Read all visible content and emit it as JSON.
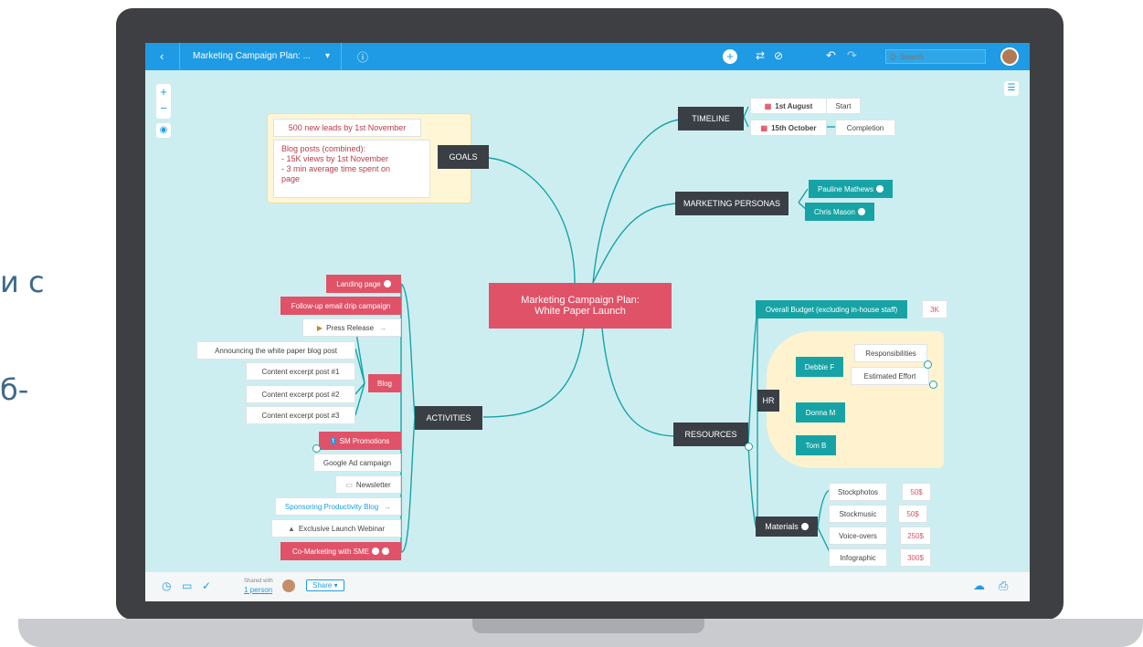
{
  "side_text": {
    "line1": "и с",
    "line2": "б-"
  },
  "header": {
    "back_icon": "chevron-left-icon",
    "doc_title": "Marketing Campaign Plan: ...",
    "dropdown_icon": "caret-down-icon",
    "info_icon": "info-icon",
    "add_icon": "plus-circle-icon",
    "search_placeholder": "Q- Search"
  },
  "left_tools": {
    "zoom_in": "+",
    "zoom_out": "−"
  },
  "central": {
    "line1": "Marketing Campaign Plan:",
    "line2": "White Paper Launch"
  },
  "goals": {
    "label": "GOALS",
    "items": [
      "500 new leads by 1st November",
      "Blog posts (combined):",
      "- 15K views by 1st November",
      "- 3 min average time spent on",
      "page"
    ]
  },
  "timeline": {
    "label": "TIMELINE",
    "dates": [
      "1st August",
      "15th October"
    ],
    "notes": [
      "Start",
      "Completion"
    ]
  },
  "personas": {
    "label": "MARKETING PERSONAS",
    "people": [
      "Pauline Mathews",
      "Chris Mason"
    ]
  },
  "activities": {
    "label": "ACTIVITIES",
    "items": [
      "Landing page",
      "Follow-up email drip campaign",
      "Press Release",
      "Blog",
      "SM Promotions",
      "Google Ad campaign",
      "Newsletter",
      "Sponsoring Productivity Blog",
      "Exclusive Launch Webinar",
      "Co-Marketing with SME"
    ],
    "blog_posts": [
      "Announcing the white paper blog post",
      "Content excerpt post #1",
      "Content excerpt post #2",
      "Content excerpt post #3"
    ]
  },
  "resources": {
    "label": "RESOURCES",
    "budget": "Overall Budget (excluding in-house staff)",
    "budget_value": "3K",
    "hr": "HR",
    "hr_people": [
      "Debbie F",
      "Donna M",
      "Tom B"
    ],
    "debbie_tasks": [
      "Responsibilities",
      "Estimated Effort"
    ],
    "materials": "Materials",
    "material_items": [
      "Stockphotos",
      "Stockmusic",
      "Voice-overs",
      "Infographic"
    ],
    "material_costs": [
      "50$",
      "50$",
      "250$",
      "300$"
    ]
  },
  "footer": {
    "shared_with": "Shared with",
    "person": "1 person",
    "share": "Share ▾"
  },
  "colors": {
    "accent": "#1e9be4",
    "canvas": "#cdeef1",
    "red": "#e05268",
    "teal": "#17a3a5",
    "dark": "#3a3f46"
  }
}
